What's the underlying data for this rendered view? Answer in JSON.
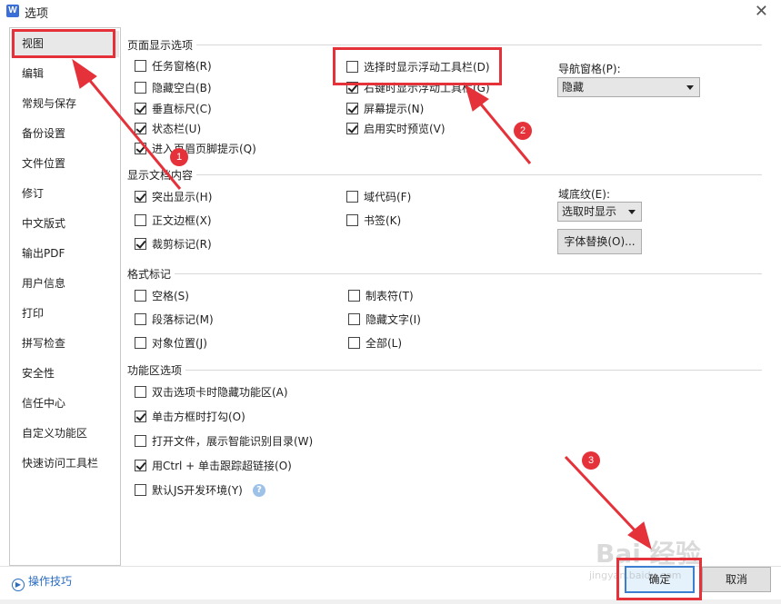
{
  "window": {
    "icon_letter": "W",
    "title": "选项",
    "close": "✕"
  },
  "sidebar": {
    "items": [
      {
        "label": "视图"
      },
      {
        "label": "编辑"
      },
      {
        "label": "常规与保存"
      },
      {
        "label": "备份设置"
      },
      {
        "label": "文件位置"
      },
      {
        "label": "修订"
      },
      {
        "label": "中文版式"
      },
      {
        "label": "输出PDF"
      },
      {
        "label": "用户信息"
      },
      {
        "label": "打印"
      },
      {
        "label": "拼写检查"
      },
      {
        "label": "安全性"
      },
      {
        "label": "信任中心"
      },
      {
        "label": "自定义功能区"
      },
      {
        "label": "快速访问工具栏"
      }
    ],
    "active": "视图"
  },
  "tips": {
    "label": "操作技巧"
  },
  "page_display": {
    "title": "页面显示选项",
    "options": [
      {
        "label": "任务窗格(R)",
        "checked": false
      },
      {
        "label": "隐藏空白(B)",
        "checked": false
      },
      {
        "label": "垂直标尺(C)",
        "checked": true
      },
      {
        "label": "状态栏(U)",
        "checked": true
      },
      {
        "label": "进入页眉页脚提示(Q)",
        "checked": true
      },
      {
        "label": "选择时显示浮动工具栏(D)",
        "checked": false
      },
      {
        "label": "右键时显示浮动工具栏(G)",
        "checked": true
      },
      {
        "label": "屏幕提示(N)",
        "checked": true
      },
      {
        "label": "启用实时预览(V)",
        "checked": true
      }
    ],
    "nav_pane_label": "导航窗格(P):",
    "nav_pane_value": "隐藏"
  },
  "doc_content": {
    "title": "显示文档内容",
    "options": [
      {
        "label": "突出显示(H)",
        "checked": true
      },
      {
        "label": "正文边框(X)",
        "checked": false
      },
      {
        "label": "裁剪标记(R)",
        "checked": true
      },
      {
        "label": "域代码(F)",
        "checked": false
      },
      {
        "label": "书签(K)",
        "checked": false
      }
    ],
    "shading_label": "域底纹(E):",
    "shading_value": "选取时显示",
    "font_replace_button": "字体替换(O)..."
  },
  "format_marks": {
    "title": "格式标记",
    "options": [
      {
        "label": "空格(S)",
        "checked": false
      },
      {
        "label": "段落标记(M)",
        "checked": false
      },
      {
        "label": "对象位置(J)",
        "checked": false
      },
      {
        "label": "制表符(T)",
        "checked": false
      },
      {
        "label": "隐藏文字(I)",
        "checked": false
      },
      {
        "label": "全部(L)",
        "checked": false
      }
    ]
  },
  "ribbon": {
    "title": "功能区选项",
    "options": [
      {
        "label": "双击选项卡时隐藏功能区(A)",
        "checked": false
      },
      {
        "label": "单击方框时打勾(O)",
        "checked": true
      },
      {
        "label": "打开文件，展示智能识别目录(W)",
        "checked": false
      },
      {
        "label": "用Ctrl + 单击跟踪超链接(O)",
        "checked": true
      },
      {
        "label": "默认JS开发环境(Y)",
        "checked": false
      }
    ],
    "help": "?"
  },
  "footer": {
    "ok_label": "确定",
    "cancel_label": "取消"
  },
  "annotations": {
    "badges": [
      "1",
      "2",
      "3"
    ],
    "color": "#e5323a"
  },
  "watermark": {
    "text": "Bai 经验",
    "sub": "jingyan.baidu.com"
  }
}
